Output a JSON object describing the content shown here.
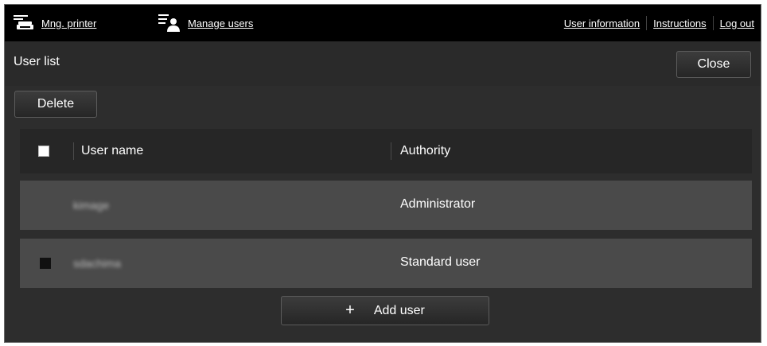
{
  "topbar": {
    "printer_link": "Mng. printer",
    "users_link": "Manage users",
    "user_information": "User information",
    "instructions": "Instructions",
    "log_out": "Log out"
  },
  "header": {
    "title": "User list",
    "close_label": "Close"
  },
  "toolbar": {
    "delete_label": "Delete"
  },
  "table": {
    "columns": [
      "User name",
      "Authority"
    ],
    "rows": [
      {
        "user_name": "kimage",
        "authority": "Administrator"
      },
      {
        "user_name": "sdachima",
        "authority": "Standard user"
      }
    ]
  },
  "footer": {
    "add_label": "Add user",
    "add_icon": "+"
  },
  "colors": {
    "topbar": "#000000",
    "panel": "#2d2d2d",
    "row": "#4a4a4a",
    "text": "#ffffff"
  }
}
